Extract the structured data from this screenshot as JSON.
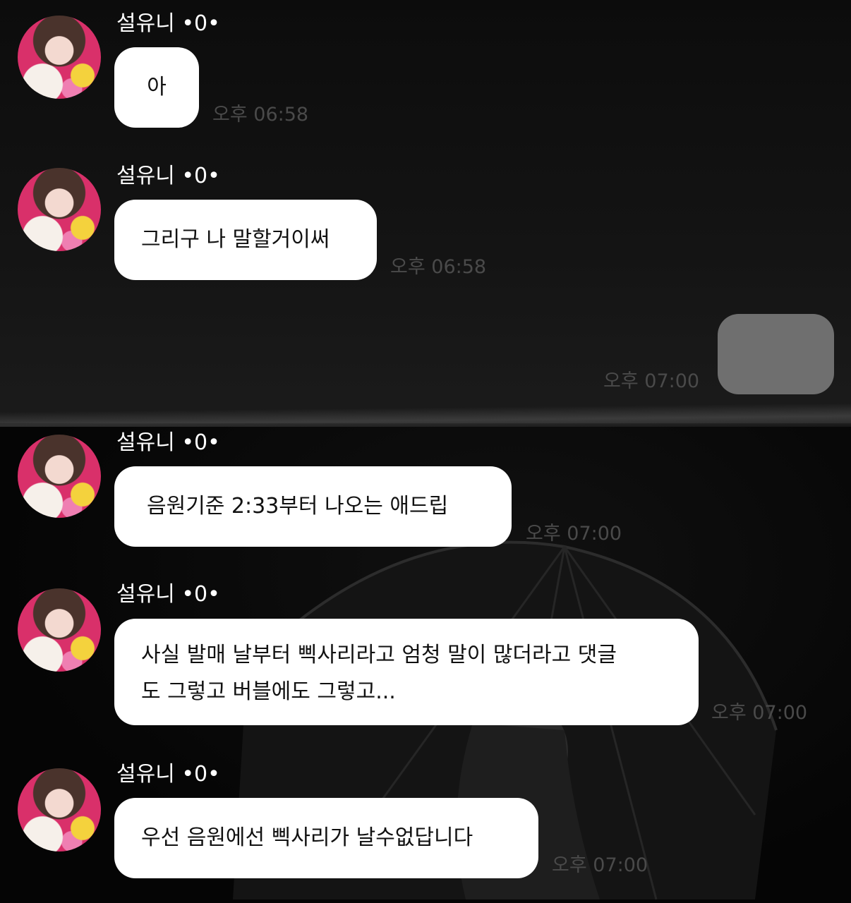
{
  "messages": [
    {
      "sender": "설유니 •0•",
      "text": "아",
      "time": "오후 06:58"
    },
    {
      "sender": "설유니 •0•",
      "text": "그리구 나 말할거이써",
      "time": "오후 06:58"
    },
    {
      "sender": "me",
      "text": "",
      "time": "오후 07:00"
    },
    {
      "sender": "설유니 •0•",
      "text": "음원기준 2:33부터 나오는 애드립",
      "time": "오후 07:00"
    },
    {
      "sender": "설유니 •0•",
      "text_line1": "사실 발매 날부터 삑사리라고 엄청 말이 많더라고 댓글",
      "text_line2": "도 그렇고 버블에도 그렇고...",
      "time": "오후 07:00"
    },
    {
      "sender": "설유니 •0•",
      "text": "우선 음원에선 삑사리가 날수없답니다",
      "time": "오후 07:00"
    }
  ],
  "colors": {
    "bubble_incoming": "#ffffff",
    "bubble_outgoing": "#6f6f6f",
    "timestamp": "#4a4a4a",
    "background": "#0a0a0a"
  }
}
